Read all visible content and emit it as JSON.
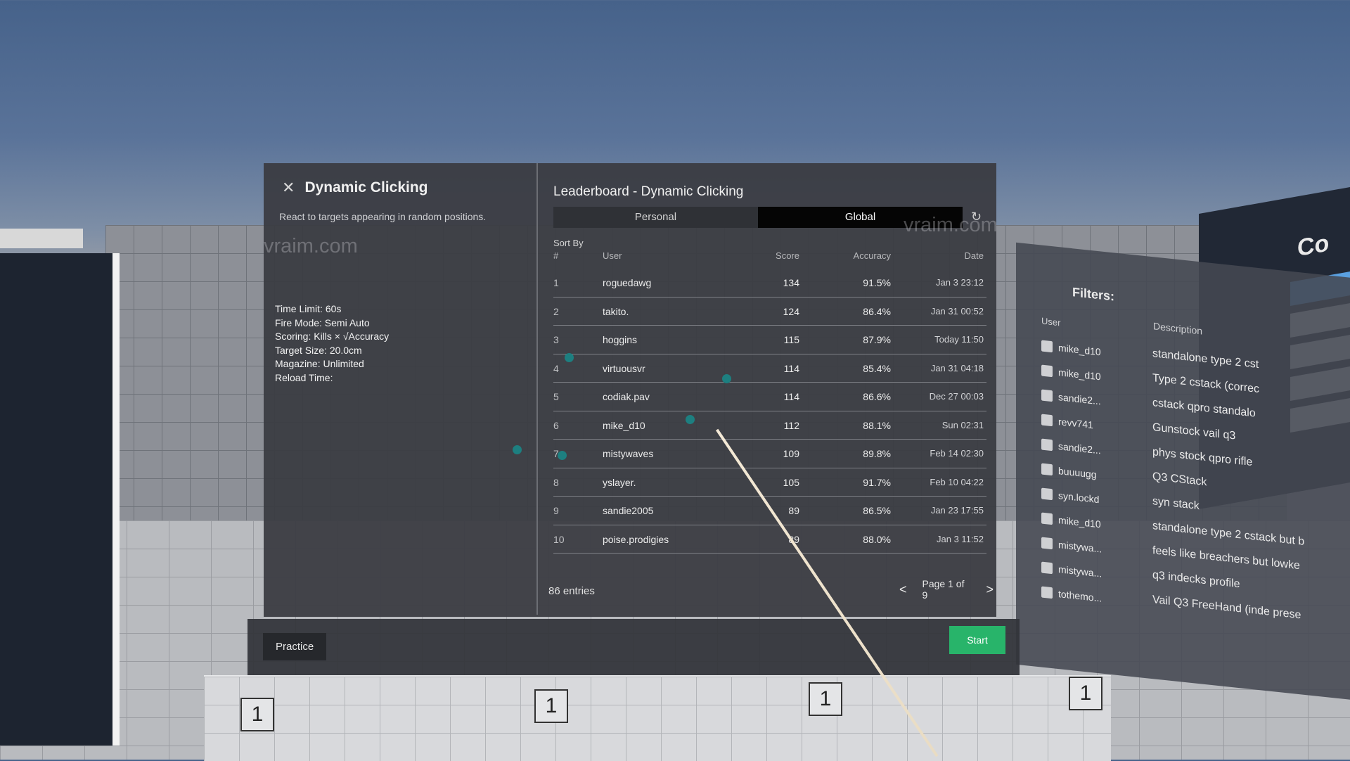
{
  "game": {
    "title": "Dynamic Clicking",
    "description": "React to targets appearing in random positions.",
    "watermark": "vraim.com",
    "settings": [
      "Time Limit: 60s",
      "Fire Mode: Semi Auto",
      "Scoring: Kills × √Accuracy",
      "Target Size: 20.0cm",
      "Magazine: Unlimited",
      "Reload Time:"
    ]
  },
  "leaderboard": {
    "title": "Leaderboard - Dynamic Clicking",
    "tabs": [
      {
        "label": "Personal",
        "active": false
      },
      {
        "label": "Global",
        "active": true
      }
    ],
    "sort_by_label": "Sort By",
    "columns": {
      "rank": "#",
      "user": "User",
      "score": "Score",
      "accuracy": "Accuracy",
      "date": "Date"
    },
    "rows": [
      {
        "rank": "1",
        "user": "roguedawg",
        "score": "134",
        "accuracy": "91.5%",
        "date": "Jan 3 23:12"
      },
      {
        "rank": "2",
        "user": "takito.",
        "score": "124",
        "accuracy": "86.4%",
        "date": "Jan 31 00:52"
      },
      {
        "rank": "3",
        "user": "hoggins",
        "score": "115",
        "accuracy": "87.9%",
        "date": "Today 11:50"
      },
      {
        "rank": "4",
        "user": "virtuousvr",
        "score": "114",
        "accuracy": "85.4%",
        "date": "Jan 31 04:18"
      },
      {
        "rank": "5",
        "user": "codiak.pav",
        "score": "114",
        "accuracy": "86.6%",
        "date": "Dec 27 00:03"
      },
      {
        "rank": "6",
        "user": "mike_d10",
        "score": "112",
        "accuracy": "88.1%",
        "date": "Sun 02:31"
      },
      {
        "rank": "7",
        "user": "mistywaves",
        "score": "109",
        "accuracy": "89.8%",
        "date": "Feb 14 02:30"
      },
      {
        "rank": "8",
        "user": "yslayer.",
        "score": "105",
        "accuracy": "91.7%",
        "date": "Feb 10 04:22"
      },
      {
        "rank": "9",
        "user": "sandie2005",
        "score": "89",
        "accuracy": "86.5%",
        "date": "Jan 23 17:55"
      },
      {
        "rank": "10",
        "user": "poise.prodigies",
        "score": "89",
        "accuracy": "88.0%",
        "date": "Jan 3 11:52"
      }
    ],
    "entries_label": "86 entries",
    "page_label": "Page 1 of 9"
  },
  "actions": {
    "practice_label": "Practice",
    "start_label": "Start"
  },
  "filters": {
    "title": "Filters:",
    "user_header": "User",
    "description_header": "Description",
    "items": [
      {
        "user": "mike_d10",
        "description": "standalone type 2 cst"
      },
      {
        "user": "mike_d10",
        "description": "Type 2 cstack (correc"
      },
      {
        "user": "sandie2...",
        "description": "cstack qpro standalo"
      },
      {
        "user": "revv741",
        "description": "Gunstock vail q3"
      },
      {
        "user": "sandie2...",
        "description": "phys stock qpro rifle"
      },
      {
        "user": "buuuugg",
        "description": "Q3 CStack"
      },
      {
        "user": "syn.lockd",
        "description": "syn stack"
      },
      {
        "user": "mike_d10",
        "description": "standalone type 2 cstack but b"
      },
      {
        "user": "mistywa...",
        "description": "feels like breachers but lowke"
      },
      {
        "user": "mistywa...",
        "description": "q3 indecks profile"
      },
      {
        "user": "tothemo...",
        "description": "Vail Q3 FreeHand (inde prese"
      }
    ]
  },
  "environment": {
    "far_panel_text": "Co",
    "pedestal_numbers": [
      "1",
      "1",
      "1",
      "1"
    ]
  }
}
